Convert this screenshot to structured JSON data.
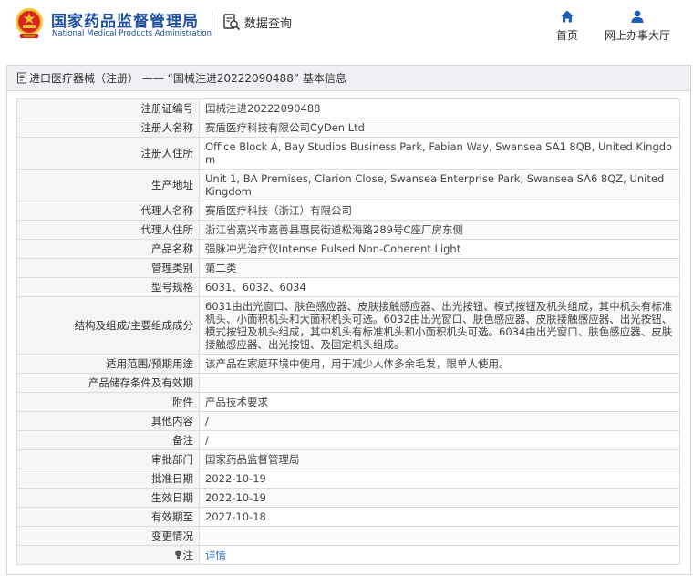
{
  "header": {
    "brand_cn": "国家药品监督管理局",
    "brand_en": "National Medical Products Administration",
    "data_query": "数据查询",
    "nav": {
      "home": "首页",
      "hall": "网上办事大厅"
    }
  },
  "panel": {
    "title": "进口医疗器械（注册） —— “国械注进20222090488” 基本信息"
  },
  "rows": [
    {
      "label": "注册证编号",
      "value": "国械注进20222090488"
    },
    {
      "label": "注册人名称",
      "value": "赛盾医疗科技有限公司CyDen Ltd"
    },
    {
      "label": "注册人住所",
      "value": "Office Block A, Bay Studios Business Park, Fabian Way, Swansea SA1 8QB, United Kingdom"
    },
    {
      "label": "生产地址",
      "value": "Unit 1, BA Premises, Clarion Close, Swansea Enterprise Park, Swansea SA6 8QZ, United Kingdom"
    },
    {
      "label": "代理人名称",
      "value": "赛盾医疗科技（浙江）有限公司"
    },
    {
      "label": "代理人住所",
      "value": "浙江省嘉兴市嘉善县惠民街道松海路289号C座厂房东侧"
    },
    {
      "label": "产品名称",
      "value": "强脉冲光治疗仪Intense Pulsed Non-Coherent Light"
    },
    {
      "label": "管理类别",
      "value": "第二类"
    },
    {
      "label": "型号规格",
      "value": "6031、6032、6034"
    },
    {
      "label": "结构及组成/主要组成成分",
      "value": "6031由出光窗口、肤色感应器、皮肤接触感应器、出光按钮、模式按钮及机头组成，其中机头有标准机头、小面积机头和大面积机头可选。6032由出光窗口、肤色感应器、皮肤接触感应器、出光按钮、模式按钮及机头组成，其中机头有标准机头和小面积机头可选。6034由出光窗口、肤色感应器、皮肤接触感应器、出光按钮、及固定机头组成。"
    },
    {
      "label": "适用范围/预期用途",
      "value": "该产品在家庭环境中使用，用于减少人体多余毛发，限单人使用。"
    },
    {
      "label": "产品储存条件及有效期",
      "value": ""
    },
    {
      "label": "附件",
      "value": "产品技术要求"
    },
    {
      "label": "其他内容",
      "value": "/"
    },
    {
      "label": "备注",
      "value": "/"
    },
    {
      "label": "审批部门",
      "value": "国家药品监督管理局"
    },
    {
      "label": "批准日期",
      "value": "2022-10-19"
    },
    {
      "label": "生效日期",
      "value": "2022-10-19"
    },
    {
      "label": "有效期至",
      "value": "2027-10-18"
    },
    {
      "label": "变更情况",
      "value": ""
    }
  ],
  "note_row": {
    "label": "注",
    "value": "详情"
  },
  "colors": {
    "brand_blue": "#1f4fa0",
    "link_blue": "#2f6cc4",
    "nav_icon_blue": "#1f5fb8",
    "emblem_red": "#d7261e",
    "emblem_gold": "#f2c230"
  }
}
